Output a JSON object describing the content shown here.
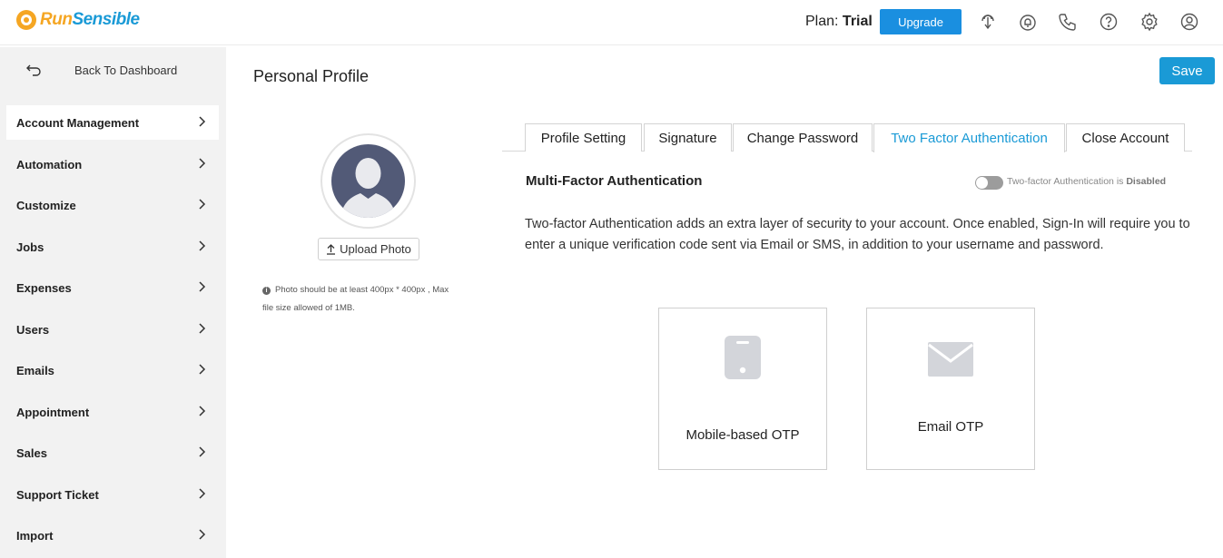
{
  "header": {
    "logo_run": "Run",
    "logo_sensible": "Sensible",
    "plan_label": "Plan:",
    "plan_value": "Trial",
    "upgrade_label": "Upgrade",
    "icons": [
      "touch-icon",
      "bell-icon",
      "phone-icon",
      "help-icon",
      "settings-icon",
      "profile-icon"
    ]
  },
  "sidebar": {
    "back_label": "Back To Dashboard",
    "items": [
      {
        "label": "Account Management",
        "active": true
      },
      {
        "label": "Automation",
        "active": false
      },
      {
        "label": "Customize",
        "active": false
      },
      {
        "label": "Jobs",
        "active": false
      },
      {
        "label": "Expenses",
        "active": false
      },
      {
        "label": "Users",
        "active": false
      },
      {
        "label": "Emails",
        "active": false
      },
      {
        "label": "Appointment",
        "active": false
      },
      {
        "label": "Sales",
        "active": false
      },
      {
        "label": "Support Ticket",
        "active": false
      },
      {
        "label": "Import",
        "active": false
      }
    ]
  },
  "main": {
    "page_title": "Personal Profile",
    "save_label": "Save",
    "upload_label": "Upload Photo",
    "photo_note_line1": "Photo should be at least 400px * 400px , Max",
    "photo_note_line2": "file size allowed of 1MB.",
    "tabs": [
      {
        "label": "Profile Setting",
        "active": false
      },
      {
        "label": "Signature",
        "active": false
      },
      {
        "label": "Change Password",
        "active": false
      },
      {
        "label": "Two Factor Authentication",
        "active": true
      },
      {
        "label": "Close Account",
        "active": false
      }
    ],
    "mfa_title": "Multi-Factor Authentication",
    "toggle_text_prefix": "Two-factor Authentication is",
    "toggle_text_state": "Disabled",
    "toggle_enabled": false,
    "description": "Two-factor Authentication adds an extra layer of security to your account. Once enabled, Sign-In will require you to enter a unique verification code sent via Email or SMS, in addition to your username and password.",
    "otp_options": [
      {
        "label": "Mobile-based OTP",
        "icon": "mobile-icon"
      },
      {
        "label": "Email OTP",
        "icon": "envelope-icon"
      }
    ]
  },
  "colors": {
    "accent": "#1a9ad6",
    "upgrade": "#1a8fe0",
    "logo_orange": "#f5a623",
    "sidebar_bg": "#f2f2f2",
    "avatar_bg": "#525a77"
  }
}
